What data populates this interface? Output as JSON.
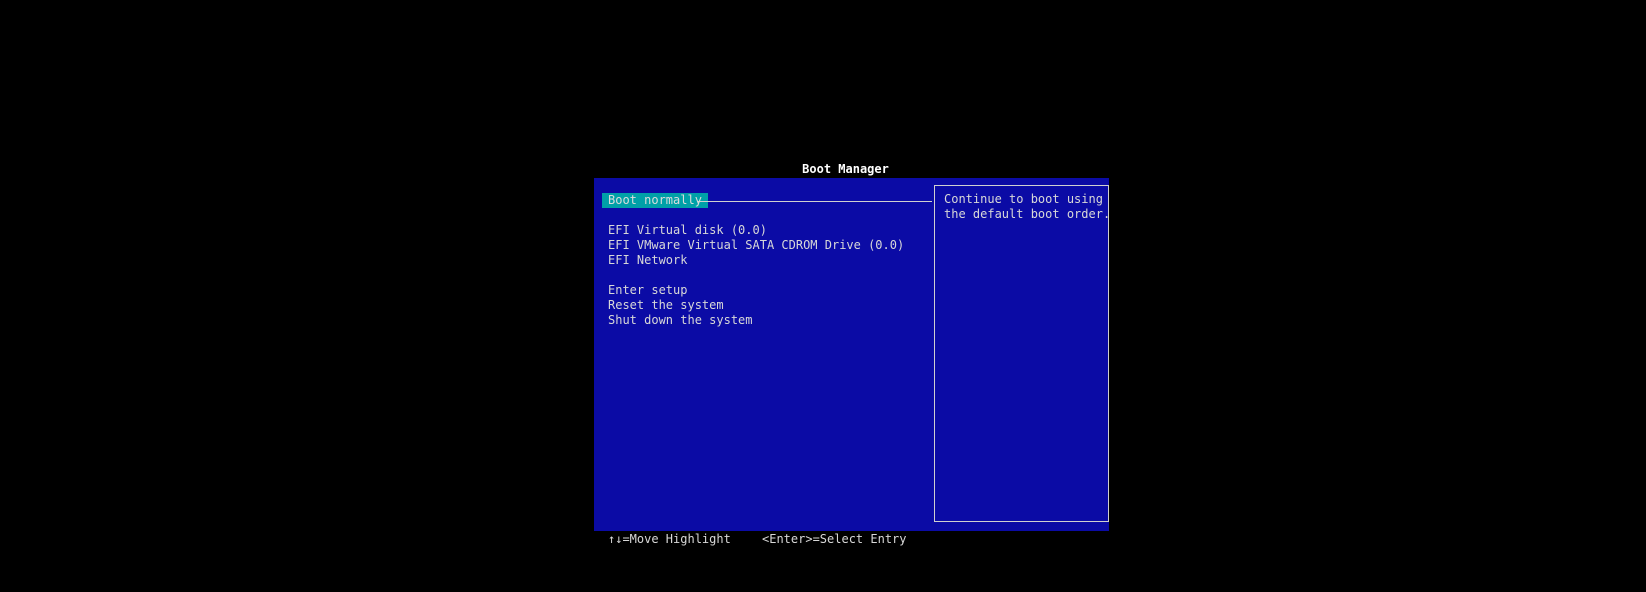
{
  "window": {
    "title": "Boot Manager"
  },
  "menu": {
    "selected_index": 0,
    "items": [
      {
        "label": "Boot normally",
        "selected": true
      },
      {
        "label": "EFI Virtual disk (0.0)",
        "selected": false
      },
      {
        "label": "EFI VMware Virtual SATA CDROM Drive (0.0)",
        "selected": false
      },
      {
        "label": "EFI Network",
        "selected": false
      },
      {
        "label": "Enter setup",
        "selected": false
      },
      {
        "label": "Reset the system",
        "selected": false
      },
      {
        "label": "Shut down the system",
        "selected": false
      }
    ]
  },
  "help": {
    "lines": [
      "Continue to boot using",
      "the default boot order."
    ]
  },
  "footer": {
    "move_hint": "↑↓=Move Highlight",
    "select_hint": "<Enter>=Select Entry"
  },
  "colors": {
    "background": "#000000",
    "panel": "#0b0ba5",
    "highlight": "#00a0a8",
    "text": "#d8d8d8",
    "title_text": "#ffffff"
  }
}
